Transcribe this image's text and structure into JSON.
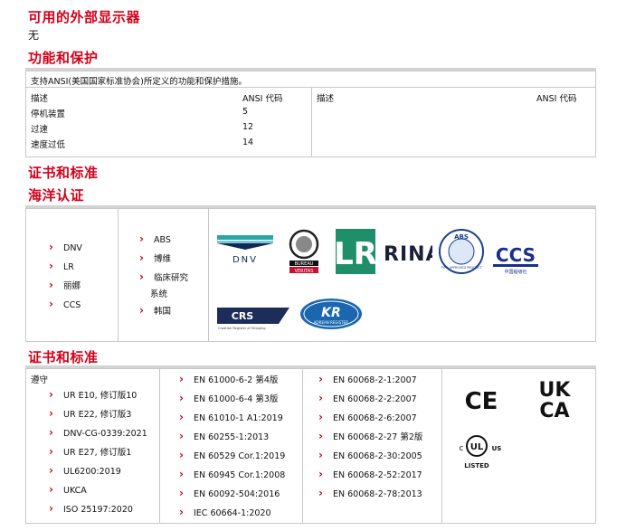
{
  "sections": {
    "display": {
      "title": "可用的外部显示器",
      "value": "无"
    },
    "protection": {
      "title": "功能和保护",
      "intro": "支持ANSI(美国国家标准协会)所定义的功能和保护措施。",
      "headers": {
        "desc": "描述",
        "code": "ANSI 代码",
        "desc2": "描述",
        "code2": "ANSI 代码"
      },
      "rows": [
        {
          "desc": "停机装置",
          "code": "5"
        },
        {
          "desc": "过速",
          "code": "12"
        },
        {
          "desc": "速度过低",
          "code": "14"
        }
      ]
    },
    "cert_title": "证书和标准",
    "marine": {
      "title": "海洋认证",
      "col1": [
        "DNV",
        "LR",
        "丽娜",
        "CCS"
      ],
      "col2": [
        "ABS",
        "博维",
        "临床研究",
        "系统",
        "韩国"
      ],
      "logos": {
        "dnv": "DNV",
        "bureau_top": "BUREAU",
        "bureau_bottom": "VERITAS",
        "lr": "LR",
        "rina": "RINA",
        "abs": "ABS",
        "abs_ring": "TYPE APPROVED PRODUCT",
        "ccs": "CCS",
        "ccs_sub": "中国船级社",
        "crs": "CRS",
        "crs_sub": "Croatian Register of Shipping",
        "kr": "KR",
        "kr_sub": "KOREAN REGISTER"
      }
    },
    "standards": {
      "title": "证书和标准",
      "comply": "遵守",
      "col1": [
        "UR E10, 修订版10",
        "UR E22, 修订版3",
        "DNV-CG-0339:2021",
        "UR E27, 修订版1",
        "UL6200:2019",
        "UKCA",
        "ISO 25197:2020"
      ],
      "col2": [
        "EN 61000-6-2 第4版",
        "EN 61000-6-4 第3版",
        "EN 61010-1 A1:2019",
        "EN 60255-1:2013",
        "EN 60529 Cor.1:2019",
        "EN 60945 Cor.1:2008",
        "EN 60092-504:2016",
        "IEC 60664-1:2020"
      ],
      "col3": [
        "EN 60068-2-1:2007",
        "EN 60068-2-2:2007",
        "EN 60068-2-6:2007",
        "EN 60068-2-27 第2版",
        "EN 60068-2-30:2005",
        "EN 60068-2-52:2017",
        "EN 60068-2-78:2013"
      ],
      "marks": {
        "ce": "CE",
        "ukca_top": "UK",
        "ukca_bottom": "CA",
        "ul_c": "c",
        "ul": "UL",
        "ul_us": "US",
        "ul_listed": "LISTED"
      }
    }
  },
  "colors": {
    "accent": "#d4001a",
    "rule": "#d3d3d3",
    "border": "#c8c8c8",
    "dnv_teal": "#2aa6a6",
    "lr_green": "#1f8f6a",
    "abs_blue": "#1b3f8b",
    "ccs_blue": "#1b2f8a",
    "crs_navy": "#1c2d5a",
    "kr_blue": "#1a67b0"
  }
}
